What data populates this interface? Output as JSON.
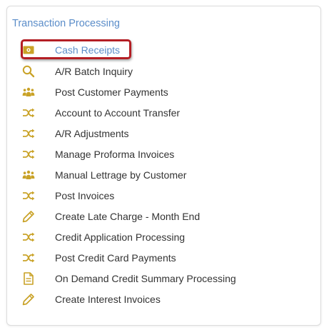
{
  "section": {
    "title": "Transaction Processing"
  },
  "colors": {
    "accent": "#5b8dc9",
    "icon_gold": "#c9a227",
    "highlight": "#b41e24"
  },
  "menu": {
    "items": [
      {
        "label": "Cash Receipts",
        "icon": "cash-icon"
      },
      {
        "label": "A/R Batch Inquiry",
        "icon": "search-icon"
      },
      {
        "label": "Post Customer Payments",
        "icon": "users-icon"
      },
      {
        "label": "Account to Account Transfer",
        "icon": "shuffle-icon"
      },
      {
        "label": "A/R Adjustments",
        "icon": "shuffle-icon"
      },
      {
        "label": "Manage Proforma Invoices",
        "icon": "shuffle-icon"
      },
      {
        "label": "Manual Lettrage by Customer",
        "icon": "users-icon"
      },
      {
        "label": "Post Invoices",
        "icon": "shuffle-icon"
      },
      {
        "label": "Create Late Charge - Month End",
        "icon": "pencil-icon"
      },
      {
        "label": "Credit Application Processing",
        "icon": "shuffle-icon"
      },
      {
        "label": "Post Credit Card Payments",
        "icon": "shuffle-icon"
      },
      {
        "label": "On Demand Credit Summary Processing",
        "icon": "document-icon"
      },
      {
        "label": "Create Interest Invoices",
        "icon": "pencil-icon"
      }
    ]
  }
}
